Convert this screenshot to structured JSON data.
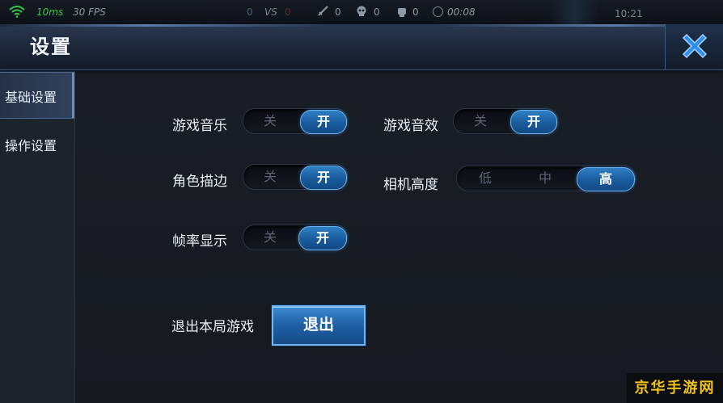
{
  "hud": {
    "ping": "10ms",
    "fps": "30 FPS",
    "score_left": "0",
    "vs": "VS",
    "score_right": "0",
    "kills": "0",
    "deaths": "0",
    "assists": "0",
    "time": "00:08",
    "corner_text": "10:21"
  },
  "panel": {
    "title": "设置"
  },
  "sidebar": {
    "tabs": [
      {
        "label": "基础设置",
        "active": true
      },
      {
        "label": "操作设置",
        "active": false
      }
    ]
  },
  "settings": {
    "game_music": {
      "label": "游戏音乐",
      "off": "关",
      "on": "开",
      "value": "开"
    },
    "game_sfx": {
      "label": "游戏音效",
      "off": "关",
      "on": "开",
      "value": "开"
    },
    "outline": {
      "label": "角色描边",
      "off": "关",
      "on": "开",
      "value": "开"
    },
    "camera_height": {
      "label": "相机高度",
      "low": "低",
      "mid": "中",
      "high": "高",
      "value": "高"
    },
    "fps_display": {
      "label": "帧率显示",
      "off": "关",
      "on": "开",
      "value": "开"
    },
    "exit": {
      "label": "退出本局游戏",
      "button": "退出"
    }
  },
  "watermark": "京华手游网",
  "colors": {
    "accent_blue": "#1a5b9c",
    "ping_green": "#37c84a",
    "close_x": "#2c8ff0",
    "watermark_yellow": "#f0c419"
  },
  "icons": [
    "wifi-icon",
    "sword-icon",
    "skull-icon",
    "fist-icon",
    "clock-icon",
    "close-icon"
  ]
}
